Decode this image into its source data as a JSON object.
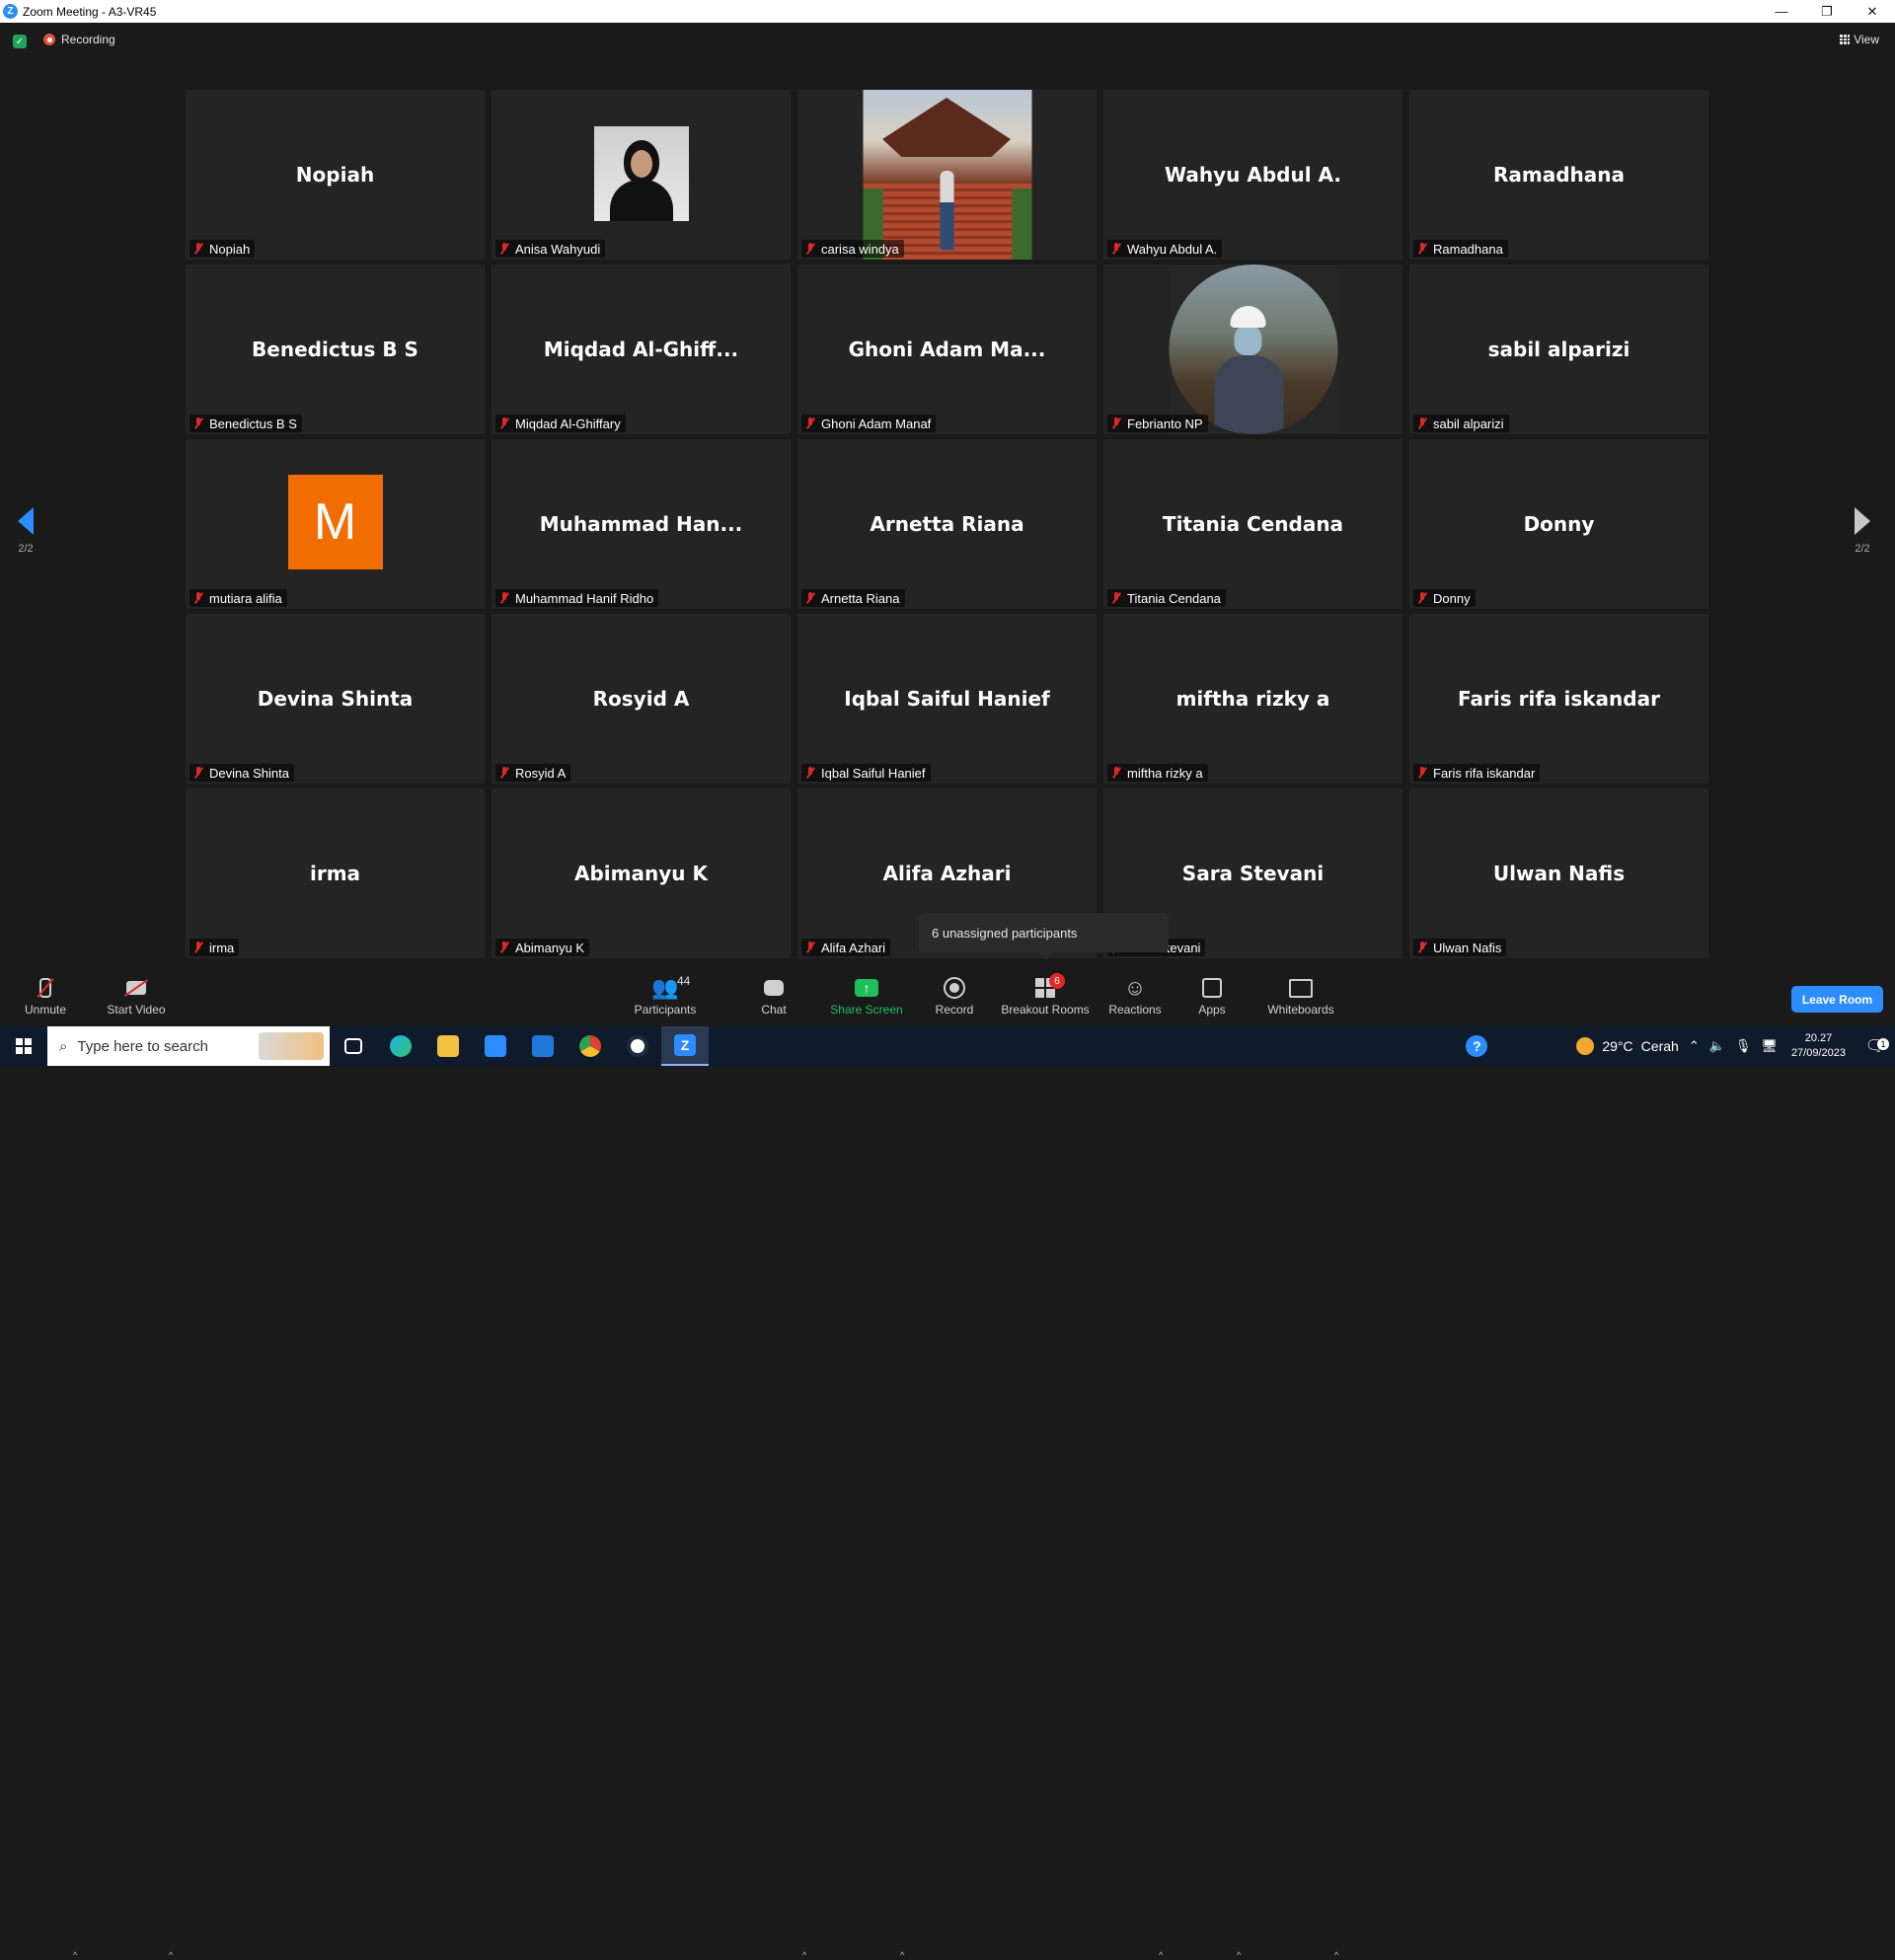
{
  "window": {
    "title": "Zoom Meeting - A3-VR45"
  },
  "topbar": {
    "recording_label": "Recording",
    "view_label": "View"
  },
  "colors": {
    "accent": "#2d8cff",
    "share_green": "#1fbf5c",
    "muted_red": "#e02828",
    "avatar_orange": "#f26d00",
    "tile_bg": "#242424",
    "background": "#1a1a1a"
  },
  "pager": {
    "left_label": "2/2",
    "right_label": "2/2"
  },
  "tiles": [
    {
      "display": "Nopiah",
      "label": "Nopiah",
      "muted": true
    },
    {
      "display": "",
      "label": "Anisa Wahyudi",
      "muted": true,
      "media": "photo"
    },
    {
      "display": "",
      "label": "carisa windya",
      "muted": true,
      "media": "video"
    },
    {
      "display": "Wahyu Abdul A.",
      "label": "Wahyu Abdul A.",
      "muted": true
    },
    {
      "display": "Ramadhana",
      "label": "Ramadhana",
      "muted": true
    },
    {
      "display": "Benedictus B S",
      "label": "Benedictus B S",
      "muted": true
    },
    {
      "display": "Miqdad  Al-Ghiff...",
      "label": "Miqdad Al-Ghiffary",
      "muted": true
    },
    {
      "display": "Ghoni  Adam  Ma...",
      "label": "Ghoni Adam Manaf",
      "muted": true
    },
    {
      "display": "",
      "label": "Febrianto NP",
      "muted": true,
      "media": "photo"
    },
    {
      "display": "sabil alparizi",
      "label": "sabil alparizi",
      "muted": true
    },
    {
      "display": "",
      "label": "mutiara alifia",
      "muted": true,
      "media": "avatar",
      "avatar_letter": "M"
    },
    {
      "display": "Muhammad  Han...",
      "label": "Muhammad Hanif Ridho",
      "muted": true
    },
    {
      "display": "Arnetta Riana",
      "label": "Arnetta Riana",
      "muted": true
    },
    {
      "display": "Titania Cendana",
      "label": "Titania Cendana",
      "muted": true
    },
    {
      "display": "Donny",
      "label": "Donny",
      "muted": true
    },
    {
      "display": "Devina Shinta",
      "label": "Devina Shinta",
      "muted": true
    },
    {
      "display": "Rosyid A",
      "label": "Rosyid A",
      "muted": true
    },
    {
      "display": "Iqbal Saiful Hanief",
      "label": "Iqbal Saiful Hanief",
      "muted": true
    },
    {
      "display": "miftha rizky a",
      "label": "miftha rizky a",
      "muted": true
    },
    {
      "display": "Faris rifa iskandar",
      "label": "Faris rifa iskandar",
      "muted": true
    },
    {
      "display": "irma",
      "label": "irma",
      "muted": true
    },
    {
      "display": "Abimanyu K",
      "label": "Abimanyu K",
      "muted": true
    },
    {
      "display": "Alifa Azhari",
      "label": "Alifa Azhari",
      "muted": true
    },
    {
      "display": "Sara Stevani",
      "label": "Sara Stevani",
      "muted": true
    },
    {
      "display": "Ulwan Nafis",
      "label": "Ulwan Nafis",
      "muted": true
    }
  ],
  "tooltip": {
    "text": "6 unassigned participants"
  },
  "toolbar": {
    "unmute": "Unmute",
    "start_video": "Start Video",
    "participants": "Participants",
    "participants_count": "44",
    "chat": "Chat",
    "share_screen": "Share Screen",
    "record": "Record",
    "breakout_rooms": "Breakout Rooms",
    "breakout_badge": "6",
    "reactions": "Reactions",
    "apps": "Apps",
    "whiteboards": "Whiteboards",
    "leave": "Leave Room"
  },
  "taskbar": {
    "search_placeholder": "Type here to search",
    "weather_temp": "29°C",
    "weather_desc": "Cerah",
    "time": "20.27",
    "date": "27/09/2023",
    "notification_count": "1",
    "apps": [
      "task-view",
      "edge",
      "file-explorer",
      "store",
      "mail",
      "chrome",
      "app",
      "zoom"
    ]
  }
}
